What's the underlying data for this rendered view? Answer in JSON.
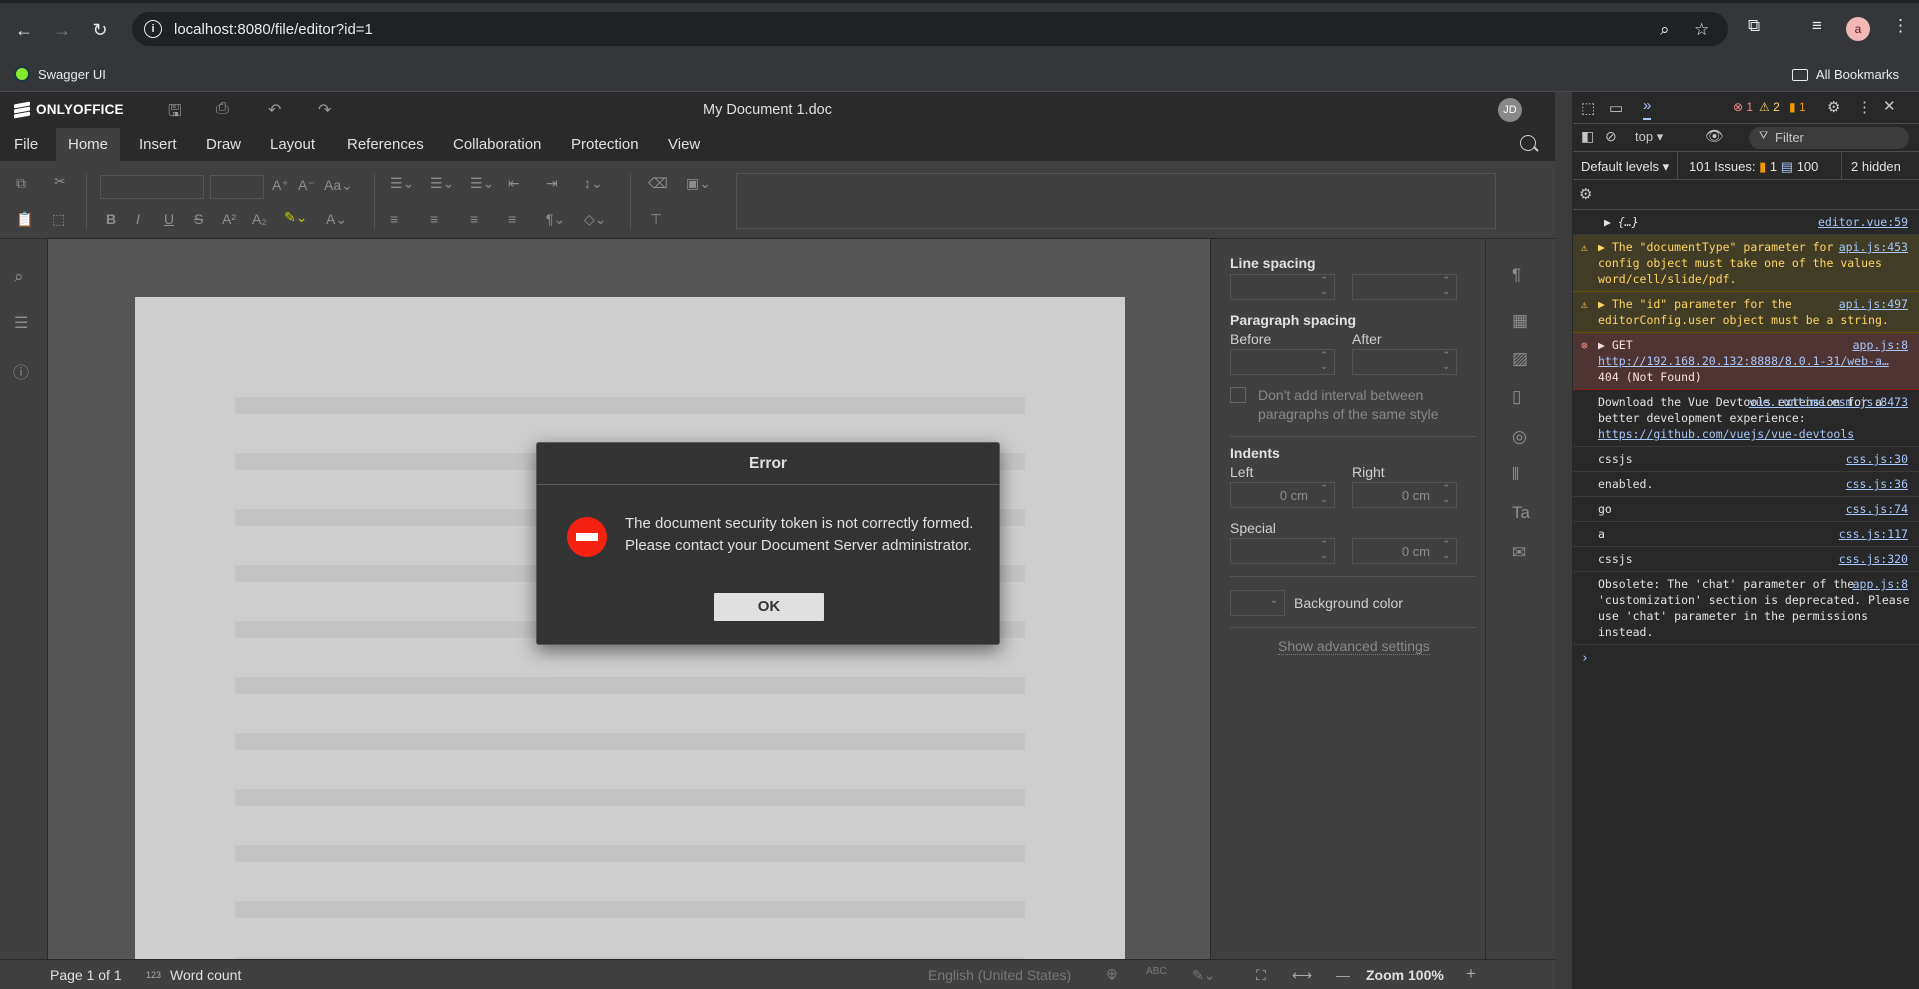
{
  "browser": {
    "url": "localhost:8080/file/editor?id=1",
    "bookmark": "Swagger UI",
    "all_bookmarks": "All Bookmarks",
    "profile_initial": "a"
  },
  "editor": {
    "logo": "ONLYOFFICE",
    "doc_title": "My Document 1.doc",
    "user_initials": "JD",
    "menu": [
      "File",
      "Home",
      "Insert",
      "Draw",
      "Layout",
      "References",
      "Collaboration",
      "Protection",
      "View"
    ],
    "active_menu": "Home",
    "right_panel": {
      "line_spacing": "Line spacing",
      "paragraph_spacing": "Paragraph spacing",
      "before": "Before",
      "after": "After",
      "dont_add_interval": "Don't add interval between paragraphs of the same style",
      "indents": "Indents",
      "left": "Left",
      "right": "Right",
      "left_value": "0 cm",
      "right_value": "0 cm",
      "special": "Special",
      "special_value": "0 cm",
      "background_color": "Background color",
      "show_advanced": "Show advanced settings"
    },
    "status": {
      "page": "Page 1 of 1",
      "word_count": "Word count",
      "language": "English (United States)",
      "zoom": "Zoom 100%"
    }
  },
  "dialog": {
    "title": "Error",
    "message_line1": "The document security token is not correctly formed.",
    "message_line2": "Please contact your Document Server administrator.",
    "ok_label": "OK"
  },
  "devtools": {
    "errors_count": "1",
    "warnings_count": "2",
    "issues_badge": "1",
    "context": "top",
    "filter_placeholder": "Filter",
    "default_levels": "Default levels",
    "issues_label": "101 Issues:",
    "issues_a": "1",
    "issues_b": "100",
    "hidden": "2 hidden",
    "messages": [
      {
        "type": "log",
        "text": "▶ {…}",
        "src": "editor.vue:59"
      },
      {
        "type": "warn",
        "text": "▶ The \"documentType\" parameter for the config object must take one of the values word/cell/slide/pdf.",
        "src": "api.js:453"
      },
      {
        "type": "warn",
        "text": "▶ The \"id\" parameter for the editorConfig.user object must be a string.",
        "src": "api.js:497"
      },
      {
        "type": "err",
        "text": "▶ GET",
        "link": "http://192.168.20.132:8888/8.0.1-31/web-a…",
        "text2": "404 (Not Found)",
        "src": "app.js:8"
      },
      {
        "type": "log",
        "text": "Download the Vue Devtools extension for a better development experience:",
        "link": "https://github.com/vuejs/vue-devtools",
        "src": "vue.runtime.esm.js:8473"
      },
      {
        "type": "log",
        "text": "cssjs",
        "src": "css.js:30"
      },
      {
        "type": "log",
        "text": "enabled.",
        "src": "css.js:36"
      },
      {
        "type": "log",
        "text": "go",
        "src": "css.js:74"
      },
      {
        "type": "log",
        "text": "a",
        "src": "css.js:117"
      },
      {
        "type": "log",
        "text": "cssjs",
        "src": "css.js:320"
      },
      {
        "type": "log",
        "text": "Obsolete: The 'chat' parameter of the 'customization' section is deprecated. Please use 'chat' parameter in the permissions instead.",
        "src": "app.js:8"
      }
    ]
  }
}
